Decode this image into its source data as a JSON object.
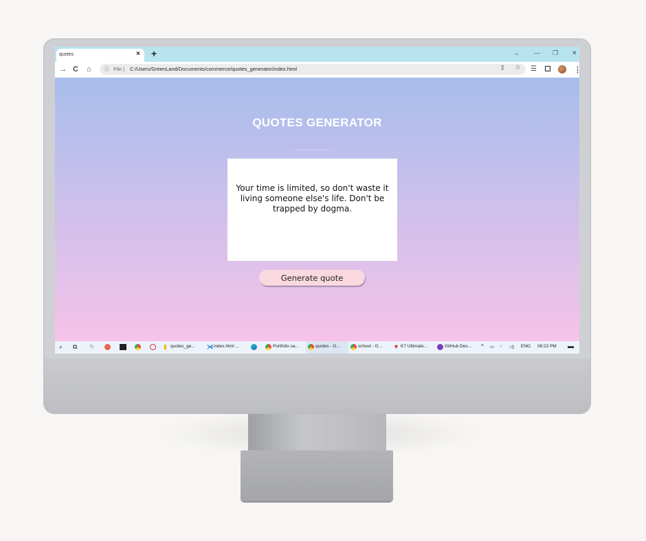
{
  "browser": {
    "tab_title": "quotes",
    "tab_close": "×",
    "new_tab": "+",
    "window_controls": [
      "⌄",
      "—",
      "❐",
      "✕"
    ],
    "nav_icons": [
      "→",
      "C",
      "⌂"
    ],
    "address": {
      "info_icon": "ⓘ",
      "scheme_label": "File |",
      "url": "C:/Users/GreenLand/Documents/commerce/quotes_generator/index.html"
    },
    "toolbar_icons": [
      "share-icon",
      "star-icon",
      "reading-list-icon",
      "side-panel-icon",
      "profile-avatar",
      "menu-icon"
    ]
  },
  "page": {
    "title": "QUOTES GENERATOR",
    "quote": "Your time is limited, so don't waste it living someone else's life. Don't be trapped by dogma.",
    "button_label": "Generate quote",
    "colors": {
      "gradient_top": "#a7bdec",
      "gradient_bottom": "#f6c3ea",
      "button_bg": "#f9d9de"
    }
  },
  "taskbar": {
    "items": [
      {
        "label": "quotes_ge...",
        "icon": "folder-icon"
      },
      {
        "label": "index.html ...",
        "icon": "vscode-icon"
      },
      {
        "label": "",
        "icon": "edge-icon"
      },
      {
        "label": "Portfolio sa...",
        "icon": "chrome-icon"
      },
      {
        "label": "quotes - G...",
        "icon": "chrome-icon"
      },
      {
        "label": "school - G...",
        "icon": "chrome-icon"
      },
      {
        "label": "K7 Ultimate...",
        "icon": "k7-icon"
      },
      {
        "label": "GitHub Des...",
        "icon": "github-icon"
      }
    ],
    "language": "ENG",
    "time": "08:22 PM"
  }
}
